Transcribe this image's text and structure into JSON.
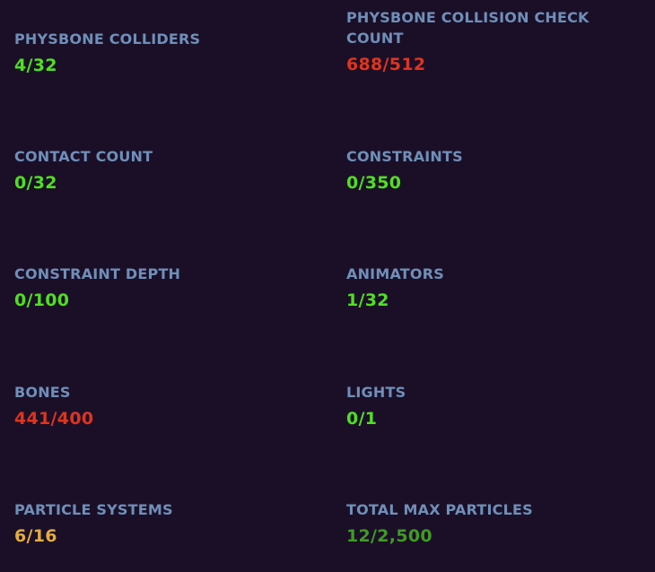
{
  "colors": {
    "background": "#1b0f28",
    "label": "#6f8fb8",
    "ok": "#4fe01f",
    "over": "#e0341c",
    "warn": "#e3ac3e",
    "good_dark": "#3e9c22"
  },
  "stats": {
    "physbone_colliders": {
      "label": "PHYSBONE COLLIDERS",
      "value": "4/32",
      "status": "ok"
    },
    "physbone_collision_check_count": {
      "label": "PHYSBONE COLLISION CHECK COUNT",
      "value": "688/512",
      "status": "over"
    },
    "contact_count": {
      "label": "CONTACT COUNT",
      "value": "0/32",
      "status": "ok"
    },
    "constraints": {
      "label": "CONSTRAINTS",
      "value": "0/350",
      "status": "ok"
    },
    "constraint_depth": {
      "label": "CONSTRAINT DEPTH",
      "value": "0/100",
      "status": "ok"
    },
    "animators": {
      "label": "ANIMATORS",
      "value": "1/32",
      "status": "ok"
    },
    "bones": {
      "label": "BONES",
      "value": "441/400",
      "status": "over"
    },
    "lights": {
      "label": "LIGHTS",
      "value": "0/1",
      "status": "ok"
    },
    "particle_systems": {
      "label": "PARTICLE SYSTEMS",
      "value": "6/16",
      "status": "warn"
    },
    "total_max_particles": {
      "label": "TOTAL MAX PARTICLES",
      "value": "12/2,500",
      "status": "good_dark"
    }
  }
}
